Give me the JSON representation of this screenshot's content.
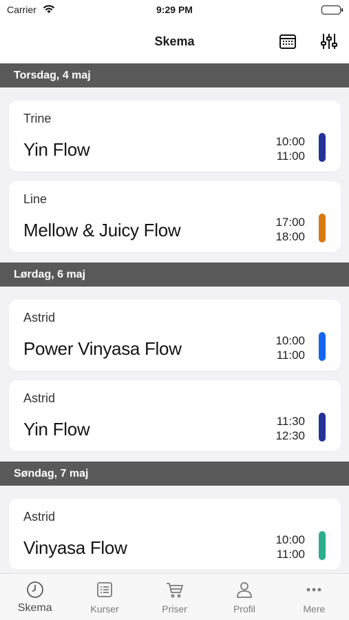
{
  "status_bar": {
    "carrier": "Carrier",
    "time": "9:29 PM"
  },
  "nav": {
    "title": "Skema",
    "calendar_icon": "calendar-icon",
    "filter_icon": "sliders-icon"
  },
  "days": [
    {
      "label": "Torsdag, 4 maj",
      "classes": [
        {
          "instructor": "Trine",
          "name": "Yin Flow",
          "start": "10:00",
          "end": "11:00",
          "color": "#24339a"
        },
        {
          "instructor": "Line",
          "name": "Mellow & Juicy Flow",
          "start": "17:00",
          "end": "18:00",
          "color": "#d9790f"
        }
      ]
    },
    {
      "label": "Lørdag, 6 maj",
      "classes": [
        {
          "instructor": "Astrid",
          "name": "Power Vinyasa Flow",
          "start": "10:00",
          "end": "11:00",
          "color": "#1565f0"
        },
        {
          "instructor": "Astrid",
          "name": "Yin Flow",
          "start": "11:30",
          "end": "12:30",
          "color": "#24339a"
        }
      ]
    },
    {
      "label": "Søndag, 7 maj",
      "classes": [
        {
          "instructor": "Astrid",
          "name": "Vinyasa Flow",
          "start": "10:00",
          "end": "11:00",
          "color": "#2bae8c"
        }
      ]
    }
  ],
  "tabs": [
    {
      "label": "Skema",
      "icon": "clock-icon",
      "active": true
    },
    {
      "label": "Kurser",
      "icon": "list-icon",
      "active": false
    },
    {
      "label": "Priser",
      "icon": "cart-icon",
      "active": false
    },
    {
      "label": "Profil",
      "icon": "person-icon",
      "active": false
    },
    {
      "label": "Mere",
      "icon": "more-icon",
      "active": false
    }
  ]
}
